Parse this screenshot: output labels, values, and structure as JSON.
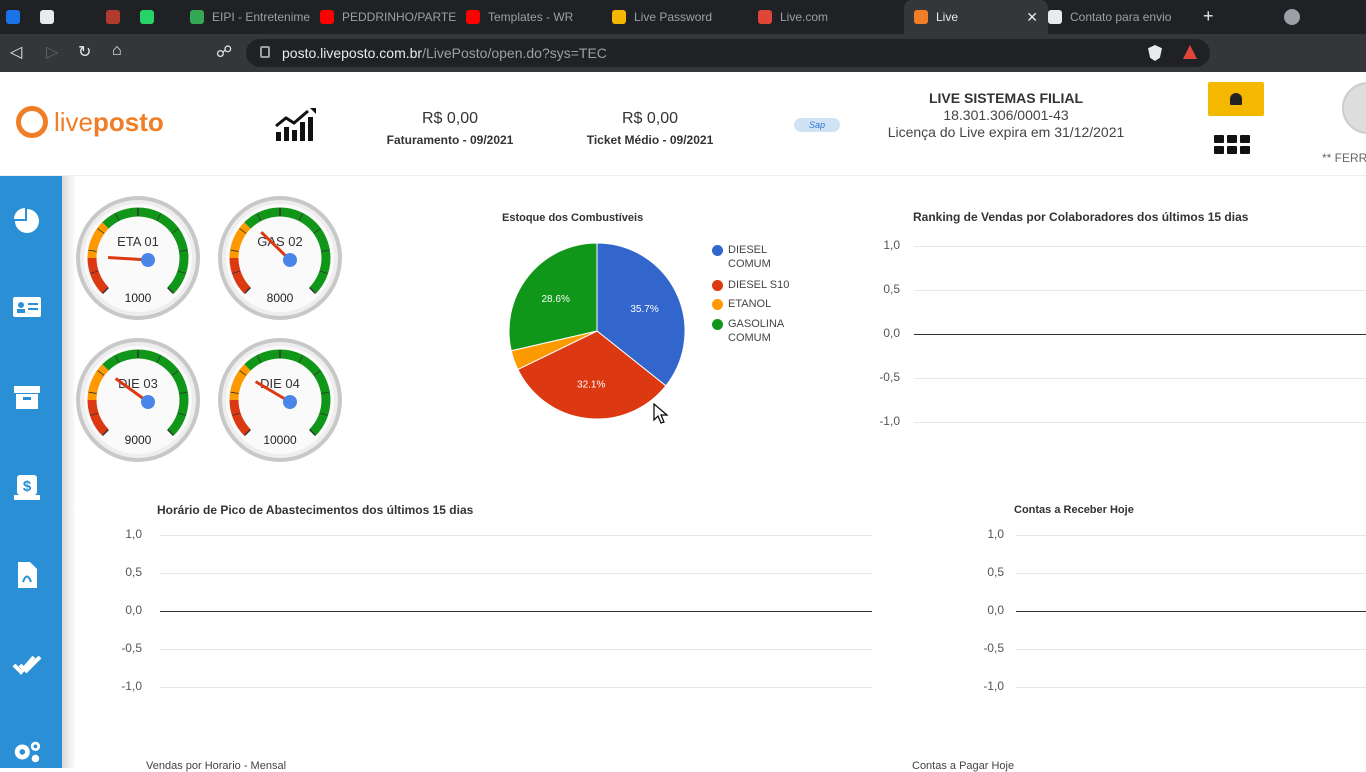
{
  "browser": {
    "tabs": [
      {
        "label": "",
        "fav": "#1a73e8"
      },
      {
        "label": "",
        "fav": "#e8eaed"
      },
      {
        "label": "",
        "fav": "#b03a2e"
      },
      {
        "label": "",
        "fav": "#25d366"
      },
      {
        "label": "EIPI - Entretenimento",
        "fav": "#34a853"
      },
      {
        "label": "PEDDRINHO/PARTE",
        "fav": "#ff0000"
      },
      {
        "label": "Templates - WR",
        "fav": "#ff0000"
      },
      {
        "label": "Live Password",
        "fav": "#f5b800"
      },
      {
        "label": "Live.com",
        "fav": "#e0453a"
      },
      {
        "label": "Live",
        "fav": "#f07e26"
      },
      {
        "label": "Contato para envio",
        "fav": "#e8eaed"
      }
    ],
    "new_tab": "+",
    "url_host": "posto.liveposto.com.br",
    "url_path": "/LivePosto/open.do?sys=TEC"
  },
  "header": {
    "logo_live": "live",
    "logo_posto": "posto",
    "faturamento_value": "R$ 0,00",
    "faturamento_label": "Faturamento - 09/2021",
    "ticket_value": "R$ 0,00",
    "ticket_label": "Ticket Médio - 09/2021",
    "partner_logo": "Sap",
    "company_name": "LIVE SISTEMAS FILIAL",
    "company_cnpj": "18.301.306/0001-43",
    "license_text": "Licença do Live expira em 31/12/2021",
    "user_name": "** FERR",
    "accent_color": "#f5b800"
  },
  "sidebar": {
    "color": "#2b8fd6",
    "items": [
      "pie-chart-icon",
      "id-card-icon",
      "box-icon",
      "money-bag-icon",
      "pdf-file-icon",
      "double-check-icon",
      "settings-icon"
    ]
  },
  "gauges": [
    {
      "label": "ETA 01",
      "value": "1000",
      "needle": 0.18
    },
    {
      "label": "GAS 02",
      "value": "8000",
      "needle": 0.33
    },
    {
      "label": "DIE 03",
      "value": "9000",
      "needle": 0.3
    },
    {
      "label": "DIE 04",
      "value": "10000",
      "needle": 0.28
    }
  ],
  "charts": {
    "stock_title": "Estoque dos Combustíveis",
    "ranking_title": "Ranking de Vendas por Colaboradores dos últimos 15 dias",
    "peak_title": "Horário de Pico de Abastecimentos dos últimos 15 dias",
    "receivable_title": "Contas a Receber Hoje",
    "footer_left": "Vendas por Horario - Mensal",
    "footer_right": "Contas a Pagar Hoje"
  },
  "chart_data": [
    {
      "type": "pie",
      "title": "Estoque dos Combustíveis",
      "slices": [
        {
          "name": "DIESEL COMUM",
          "value": 35.7,
          "label": "35.7%",
          "color": "#3366cc"
        },
        {
          "name": "DIESEL S10",
          "value": 32.1,
          "label": "32.1%",
          "color": "#dc3912"
        },
        {
          "name": "ETANOL",
          "value": 3.6,
          "label": "",
          "color": "#ff9900"
        },
        {
          "name": "GASOLINA COMUM",
          "value": 28.6,
          "label": "28.6%",
          "color": "#109618"
        }
      ],
      "legend": "right"
    },
    {
      "type": "line",
      "title": "Ranking de Vendas por Colaboradores dos últimos 15 dias",
      "yticks": [
        "1,0",
        "0,5",
        "0,0",
        "-0,5",
        "-1,0"
      ],
      "ylim": [
        -1,
        1
      ],
      "series": []
    },
    {
      "type": "line",
      "title": "Horário de Pico de Abastecimentos dos últimos 15 dias",
      "yticks": [
        "1,0",
        "0,5",
        "0,0",
        "-0,5",
        "-1,0"
      ],
      "ylim": [
        -1,
        1
      ],
      "series": []
    },
    {
      "type": "line",
      "title": "Contas a Receber Hoje",
      "yticks": [
        "1,0",
        "0,5",
        "0,0",
        "-0,5",
        "-1,0"
      ],
      "ylim": [
        -1,
        1
      ],
      "series": []
    }
  ]
}
